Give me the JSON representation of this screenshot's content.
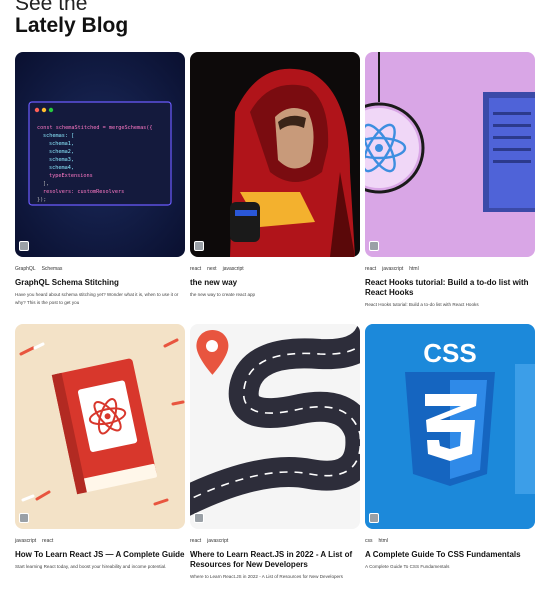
{
  "heading": {
    "pre": "See the",
    "main": "Lately Blog"
  },
  "cards": [
    {
      "tags": [
        "GraphQL",
        "Schemas"
      ],
      "title": "GraphQL Schema Stitching",
      "desc": "Have you heard about schema stitching yet? Wonder what it is, when to use it or why? This is the post to get you",
      "thumb": "code"
    },
    {
      "tags": [
        "react",
        "next",
        "javascript"
      ],
      "title": "the new way",
      "desc": "the new way to create react app",
      "thumb": "hoodie"
    },
    {
      "tags": [
        "react",
        "javascript",
        "html"
      ],
      "title": "React Hooks tutorial: Build a to-do list with React Hooks",
      "desc": "React Hooks tutorial: Build a to-do list with React Hooks",
      "thumb": "hooks"
    },
    {
      "tags": [
        "javascript",
        "react"
      ],
      "title": "How To Learn React JS — A Complete Guide",
      "desc": "Start learning React today, and boost your hireability and income potential.",
      "thumb": "book"
    },
    {
      "tags": [
        "react",
        "javascript"
      ],
      "title": "Where to Learn React.JS in 2022 - A List of Resources for New Developers",
      "desc": "Where to Learn React.JS in 2022 - A List of Resources for New Developers",
      "thumb": "road"
    },
    {
      "tags": [
        "css",
        "html"
      ],
      "title": "A Complete Guide To CSS Fundamentals",
      "desc": "A Complete Guide To CSS Fundamentals",
      "thumb": "css"
    }
  ],
  "code": {
    "l1": "const schemaStitched = mergeSchemas({",
    "l2": "schemas: [",
    "l3": "schema1,",
    "l4": "schema2,",
    "l5": "schema3,",
    "l6": "schema4,",
    "l7": "typeExtensions",
    "l8": "],",
    "l9": "resolvers: customResolvers",
    "l10": "});"
  },
  "css_badge": "CSS"
}
